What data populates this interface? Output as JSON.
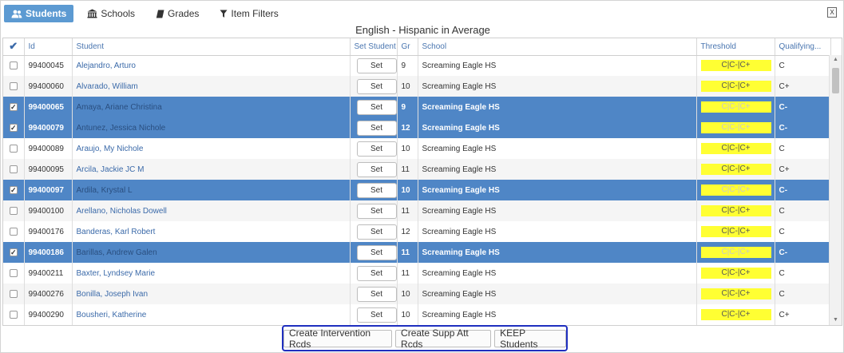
{
  "tabs": [
    {
      "label": "Students",
      "icon": "users-icon",
      "active": true
    },
    {
      "label": "Schools",
      "icon": "building-icon",
      "active": false
    },
    {
      "label": "Grades",
      "icon": "book-icon",
      "active": false
    },
    {
      "label": "Item Filters",
      "icon": "filter-icon",
      "active": false
    }
  ],
  "export_label": "X",
  "grid_title": "English - Hispanic in Average",
  "columns": {
    "check": "✔",
    "id": "Id",
    "student": "Student",
    "set_student": "Set Student",
    "gr": "Gr",
    "school": "School",
    "threshold": "Threshold",
    "qualifying": "Qualifying..."
  },
  "rows": [
    {
      "checked": false,
      "id": "99400045",
      "student": "Alejandro, Arturo",
      "set": "Set",
      "gr": "9",
      "school": "Screaming Eagle HS",
      "threshold": "C|C-|C+",
      "qual": "C"
    },
    {
      "checked": false,
      "id": "99400060",
      "student": "Alvarado, William",
      "set": "Set",
      "gr": "10",
      "school": "Screaming Eagle HS",
      "threshold": "C|C-|C+",
      "qual": "C+"
    },
    {
      "checked": true,
      "id": "99400065",
      "student": "Amaya, Ariane Christina",
      "set": "Set",
      "gr": "9",
      "school": "Screaming Eagle HS",
      "threshold": "C|C-|C+",
      "qual": "C-"
    },
    {
      "checked": true,
      "id": "99400079",
      "student": "Antunez, Jessica Nichole",
      "set": "Set",
      "gr": "12",
      "school": "Screaming Eagle HS",
      "threshold": "C|C-|C+",
      "qual": "C-"
    },
    {
      "checked": false,
      "id": "99400089",
      "student": "Araujo, My Nichole",
      "set": "Set",
      "gr": "10",
      "school": "Screaming Eagle HS",
      "threshold": "C|C-|C+",
      "qual": "C"
    },
    {
      "checked": false,
      "id": "99400095",
      "student": "Arcila, Jackie JC M",
      "set": "Set",
      "gr": "11",
      "school": "Screaming Eagle HS",
      "threshold": "C|C-|C+",
      "qual": "C+"
    },
    {
      "checked": true,
      "id": "99400097",
      "student": "Ardila, Krystal L",
      "set": "Set",
      "gr": "10",
      "school": "Screaming Eagle HS",
      "threshold": "C|C-|C+",
      "qual": "C-"
    },
    {
      "checked": false,
      "id": "99400100",
      "student": "Arellano, Nicholas Dowell",
      "set": "Set",
      "gr": "11",
      "school": "Screaming Eagle HS",
      "threshold": "C|C-|C+",
      "qual": "C"
    },
    {
      "checked": false,
      "id": "99400176",
      "student": "Banderas, Karl Robert",
      "set": "Set",
      "gr": "12",
      "school": "Screaming Eagle HS",
      "threshold": "C|C-|C+",
      "qual": "C"
    },
    {
      "checked": true,
      "id": "99400186",
      "student": "Barillas, Andrew Galen",
      "set": "Set",
      "gr": "11",
      "school": "Screaming Eagle HS",
      "threshold": "C|C-|C+",
      "qual": "C-"
    },
    {
      "checked": false,
      "id": "99400211",
      "student": "Baxter, Lyndsey Marie",
      "set": "Set",
      "gr": "11",
      "school": "Screaming Eagle HS",
      "threshold": "C|C-|C+",
      "qual": "C"
    },
    {
      "checked": false,
      "id": "99400276",
      "student": "Bonilla, Joseph Ivan",
      "set": "Set",
      "gr": "10",
      "school": "Screaming Eagle HS",
      "threshold": "C|C-|C+",
      "qual": "C"
    },
    {
      "checked": false,
      "id": "99400290",
      "student": "Bousheri, Katherine",
      "set": "Set",
      "gr": "10",
      "school": "Screaming Eagle HS",
      "threshold": "C|C-|C+",
      "qual": "C+"
    }
  ],
  "actions": {
    "intervention": "Create Intervention Rcds",
    "supp_att": "Create Supp Att Rcds",
    "keep": "KEEP Students"
  },
  "colors": {
    "tab_active": "#5c9ad2",
    "row_selected": "#4f86c6",
    "threshold_highlight": "#ffff33",
    "actions_outline": "#1f2fbf"
  }
}
